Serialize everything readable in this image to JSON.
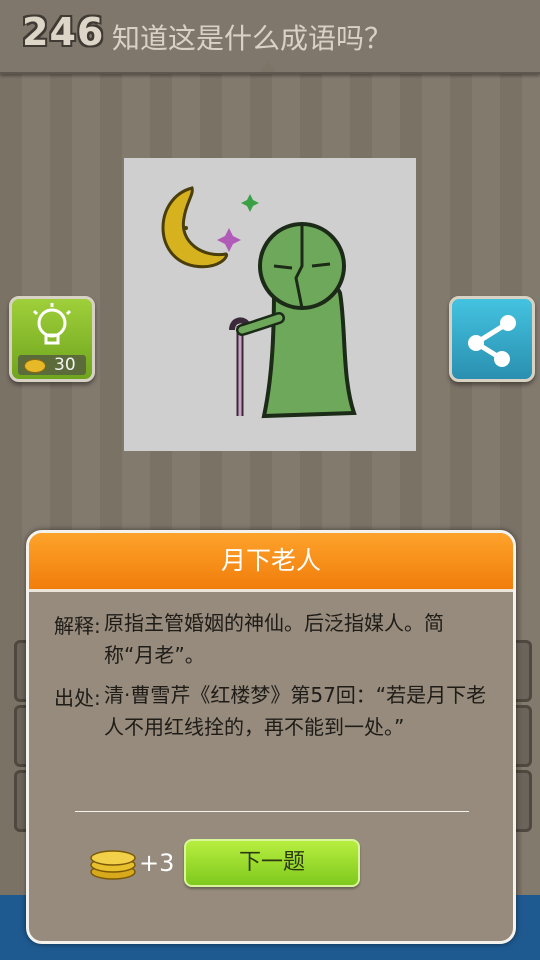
{
  "header": {
    "level": "246",
    "question": "知道这是什么成语吗？"
  },
  "hint": {
    "cost": "30",
    "icon": "lightbulb-icon"
  },
  "share": {
    "icon": "share-icon"
  },
  "modal": {
    "title": "月下老人",
    "explain_label": "解释:",
    "explain_text": "原指主管婚姻的神仙。后泛指媒人。简称“月老”。",
    "source_label": "出处:",
    "source_text": "清·曹雪芹《红楼梦》第57回：“若是月下老人不用红线拴的，再不能到一处。”",
    "reward": "+3",
    "next_label": "下一题"
  },
  "colors": {
    "header_bg": "#7f776c",
    "modal_header": "#f58a14",
    "next_button": "#9ddc2e",
    "hint_button": "#8cc031",
    "share_button": "#3aa9cc"
  }
}
